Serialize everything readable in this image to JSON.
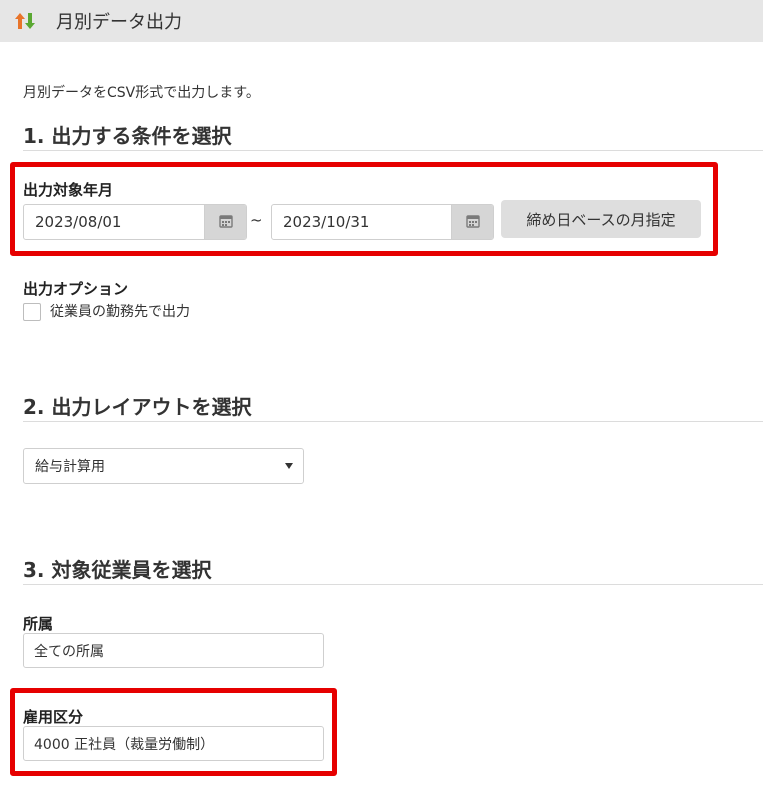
{
  "header": {
    "title": "月別データ出力",
    "icon": "sort-arrows-icon"
  },
  "intro": "月別データをCSV形式で出力します。",
  "section1": {
    "title": "1. 出力する条件を選択",
    "period_label": "出力対象年月",
    "start_date": "2023/08/01",
    "separator": "~",
    "end_date": "2023/10/31",
    "month_button": "締め日ベースの月指定",
    "option_label": "出力オプション",
    "option_checkbox_label": "従業員の勤務先で出力",
    "option_checked": false
  },
  "section2": {
    "title": "2. 出力レイアウトを選択",
    "layout_selected": "給与計算用"
  },
  "section3": {
    "title": "3. 対象従業員を選択",
    "affiliation_label": "所属",
    "affiliation_value": "全ての所属",
    "employment_label": "雇用区分",
    "employment_value": "4000 正社員（裁量労働制）"
  },
  "colors": {
    "highlight": "#e60000",
    "header_bg": "#e6e6e6",
    "up_arrow": "#e8742a",
    "down_arrow": "#5aa832"
  }
}
